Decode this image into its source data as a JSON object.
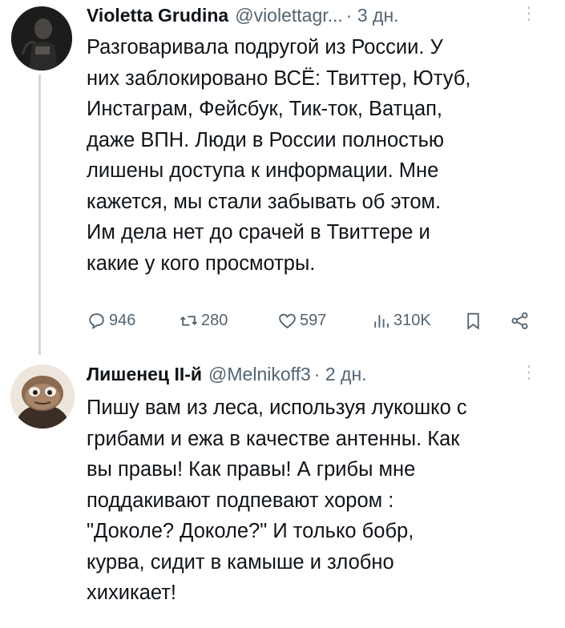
{
  "tweets": [
    {
      "author_name": "Violetta Grudina",
      "handle": "@violettagr...",
      "time": "· 3 дн.",
      "more_icon": "more-dots-icon",
      "text": "Разговаривала подругой из России. У\nних заблокировано ВСЁ: Твиттер, Ютуб,\nИнстаграм, Фейсбук, Тик-ток, Ватцап,\nдаже ВПН. Люди в России полностью\nлишены доступа к информации. Мне\nкажется, мы стали забывать об этом.\nИм дела нет до срачей в Твиттере и\nкакие у кого просмотры.",
      "actions": {
        "replies": "946",
        "retweets": "280",
        "likes": "597",
        "views": "310K"
      }
    },
    {
      "author_name": "Лишенец II-й",
      "handle": "@Melnikoff3",
      "time": "· 2 дн.",
      "more_icon": "more-dots-icon",
      "text": "Пишу вам из леса, используя лукошко с\nгрибами и ежа в качестве антенны. Как\nвы правы! Как правы! А грибы мне\nподдакивают подпевают хором :\n\"Доколе? Доколе?\" И только бобр,\nкурва, сидит в камыше и злобно\nхихикает!"
    }
  ],
  "colors": {
    "text": "#0f1419",
    "secondary": "#536471",
    "thread_line": "#cfd9de",
    "background": "#ffffff"
  }
}
